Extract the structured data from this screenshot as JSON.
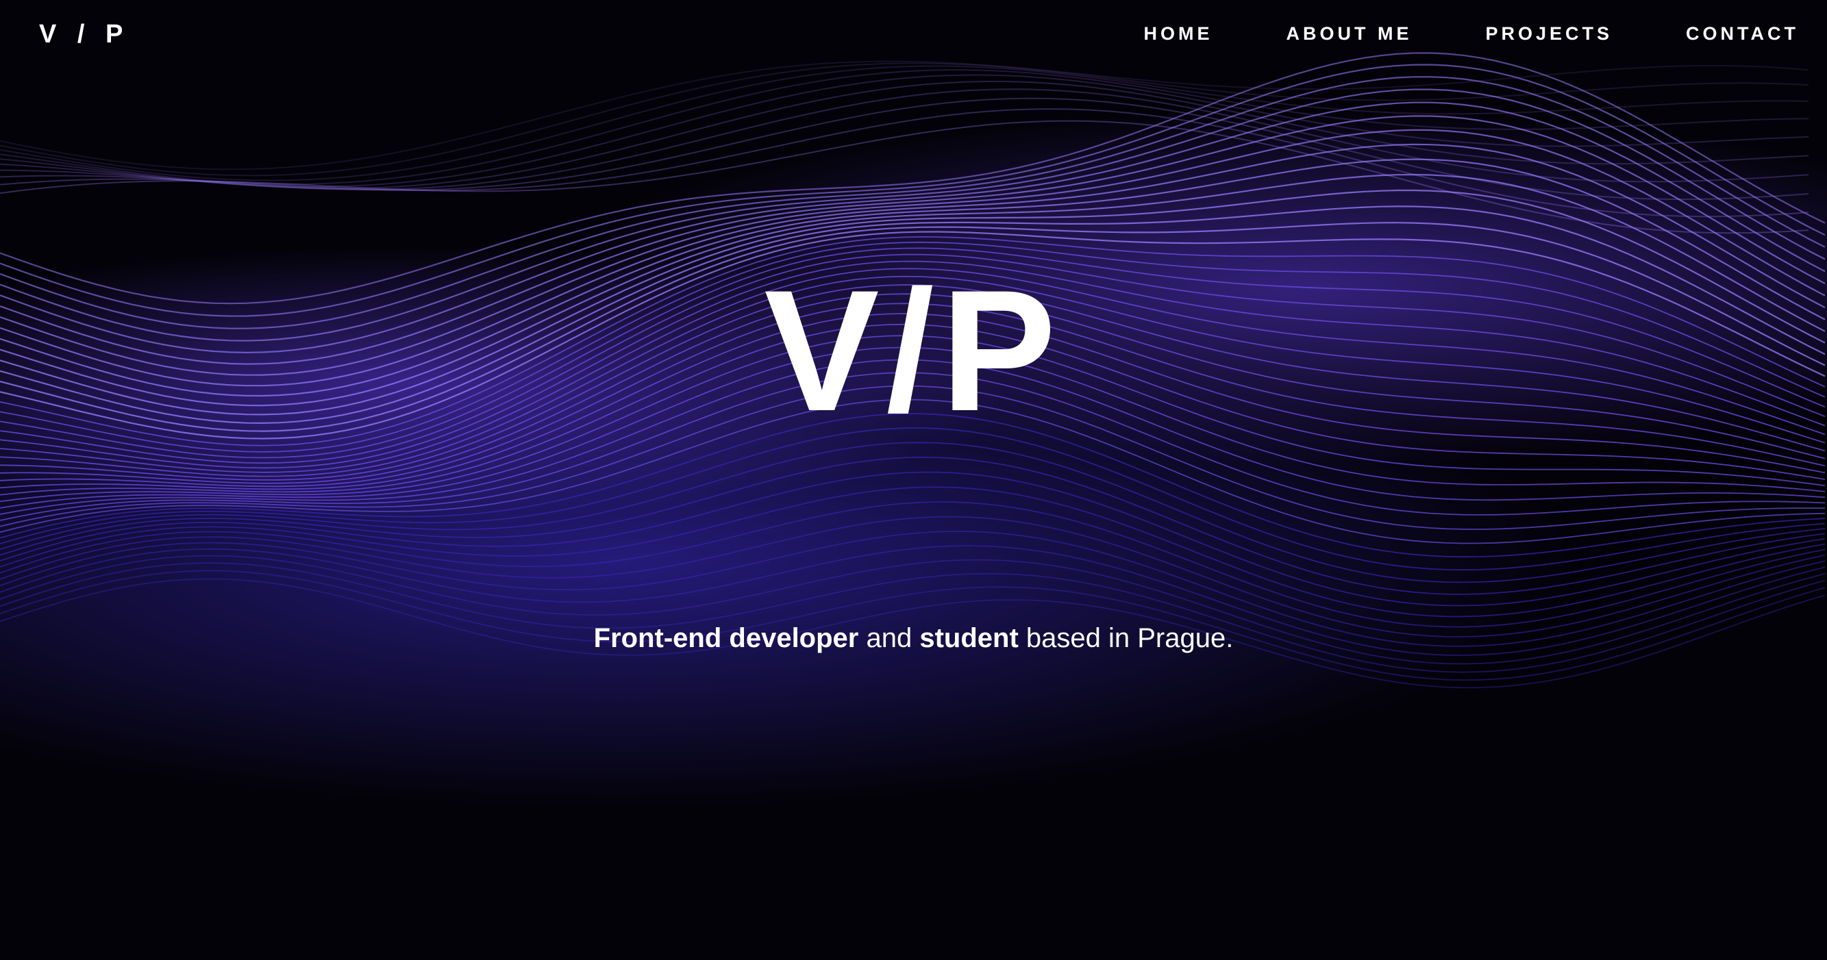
{
  "header": {
    "logo": "V / P",
    "nav": [
      {
        "label": "HOME"
      },
      {
        "label": "ABOUT ME"
      },
      {
        "label": "PROJECTS"
      },
      {
        "label": "CONTACT"
      }
    ]
  },
  "hero": {
    "title": "V/P",
    "tagline": {
      "role": "Front-end developer",
      "and": " and ",
      "status": "student",
      "rest": " based in Prague."
    }
  },
  "colors": {
    "background": "#030208",
    "wave_light": "#9a7cff",
    "wave_mid": "#6a4ae0",
    "wave_deep": "#3a26b8",
    "text": "#ffffff"
  }
}
